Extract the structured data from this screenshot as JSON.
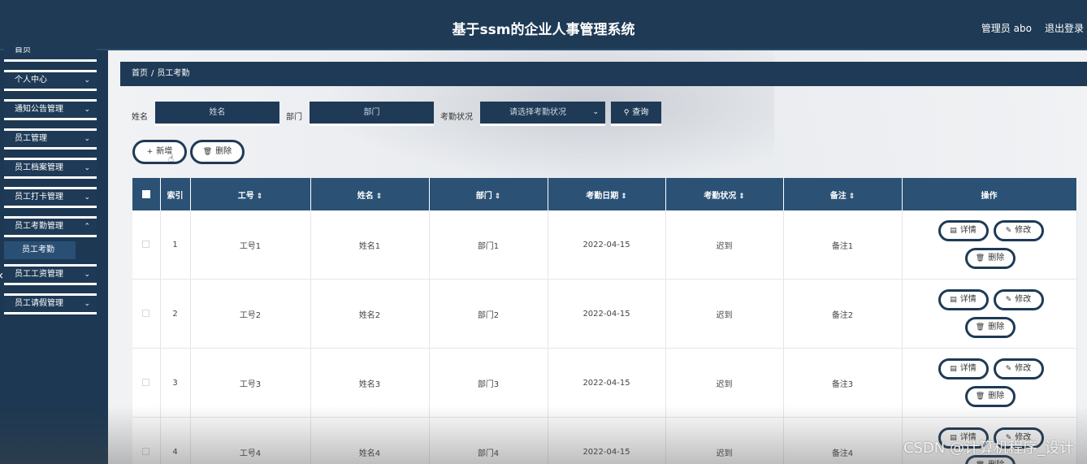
{
  "header": {
    "title": "基于ssm的企业人事管理系统",
    "user_label": "管理员 abo",
    "logout": "退出登录"
  },
  "sidebar": {
    "items": [
      {
        "label": "首页"
      },
      {
        "label": "个人中心"
      },
      {
        "label": "通知公告管理"
      },
      {
        "label": "员工管理"
      },
      {
        "label": "员工档案管理"
      },
      {
        "label": "员工打卡管理"
      },
      {
        "label": "员工考勤管理"
      },
      {
        "label": "员工工资管理"
      },
      {
        "label": "员工请假管理"
      }
    ],
    "active_submenu": "员工考勤"
  },
  "breadcrumb": {
    "home": "首页",
    "separator": "/",
    "current": "员工考勤"
  },
  "filters": {
    "name_label": "姓名",
    "name_placeholder": "姓名",
    "dept_label": "部门",
    "dept_placeholder": "部门",
    "status_label": "考勤状况",
    "status_placeholder": "请选择考勤状况",
    "query_label": "查询"
  },
  "actions": {
    "add_label": "新增",
    "delete_label": "删除"
  },
  "table": {
    "headers": {
      "index": "索引",
      "emp_no": "工号",
      "name": "姓名",
      "dept": "部门",
      "date": "考勤日期",
      "status": "考勤状况",
      "remark": "备注",
      "ops": "操作"
    },
    "rows": [
      {
        "index": "1",
        "emp_no": "工号1",
        "name": "姓名1",
        "dept": "部门1",
        "date": "2022-04-15",
        "status": "迟到",
        "remark": "备注1"
      },
      {
        "index": "2",
        "emp_no": "工号2",
        "name": "姓名2",
        "dept": "部门2",
        "date": "2022-04-15",
        "status": "迟到",
        "remark": "备注2"
      },
      {
        "index": "3",
        "emp_no": "工号3",
        "name": "姓名3",
        "dept": "部门3",
        "date": "2022-04-15",
        "status": "迟到",
        "remark": "备注3"
      },
      {
        "index": "4",
        "emp_no": "工号4",
        "name": "姓名4",
        "dept": "部门4",
        "date": "2022-04-15",
        "status": "迟到",
        "remark": "备注4"
      }
    ],
    "row_actions": {
      "detail": "详情",
      "edit": "修改",
      "delete": "删除"
    }
  },
  "watermark": "CSDN @计算机程序_设计",
  "colors": {
    "nav_bg": "#1e3a56",
    "table_header": "#2b5175"
  }
}
